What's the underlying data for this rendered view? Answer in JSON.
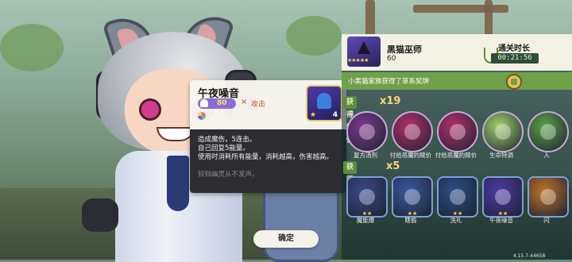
{
  "skill_tooltip": {
    "title": "午夜噪音",
    "cost": "80",
    "separator": "×",
    "type_label": "攻击",
    "level": "4",
    "description_lines": [
      "造成魔伤，5连击。",
      "自己回复5能量。",
      "使用时消耗所有能量，消耗越高，伤害越高。"
    ],
    "flavor": "铃铛幽灵从不发声。"
  },
  "confirm_button": {
    "label": "确定"
  },
  "panel": {
    "player_name": "黑猫巫师",
    "player_level": "60",
    "stars": "★★★★★",
    "clear_time_label": "通关时长",
    "clear_time_value": "00:21:56",
    "reward_text": "小黑猫家族获得了草系奖牌",
    "traits_label": "获得特性",
    "traits_count": "x19",
    "traits": [
      {
        "name": "复方汤剂",
        "icon": "potion-trait-icon",
        "color": "#7a3a8c"
      },
      {
        "name": "付给恶魔的赎价",
        "icon": "demon-ransom-icon",
        "color": "#b0306a"
      },
      {
        "name": "付给恶魔的赎价",
        "icon": "demon-ransom-icon",
        "color": "#b0306a"
      },
      {
        "name": "生命特调",
        "icon": "life-drink-icon",
        "color": "#9fd06a"
      },
      {
        "name": "入",
        "icon": "partial-trait-icon",
        "color": "#5a9f4a"
      }
    ],
    "skills_label": "获得技能",
    "skills_count": "x5",
    "skills": [
      {
        "name": "魔能爆",
        "icon": "magic-burst-icon",
        "color": "#3a4a8c",
        "stars": "★★"
      },
      {
        "name": "瞎偷",
        "icon": "thief-icon",
        "color": "#3a5aa0",
        "stars": "★★"
      },
      {
        "name": "洗礼",
        "icon": "baptism-icon",
        "color": "#2a4f88",
        "stars": "★★"
      },
      {
        "name": "午夜噪音",
        "icon": "midnight-noise-icon",
        "color": "#4d3aa8",
        "stars": "★★"
      },
      {
        "name": "闪",
        "icon": "partial-skill-icon",
        "color": "#c0742a",
        "stars": ""
      }
    ],
    "version": "4.15.7-44658"
  }
}
